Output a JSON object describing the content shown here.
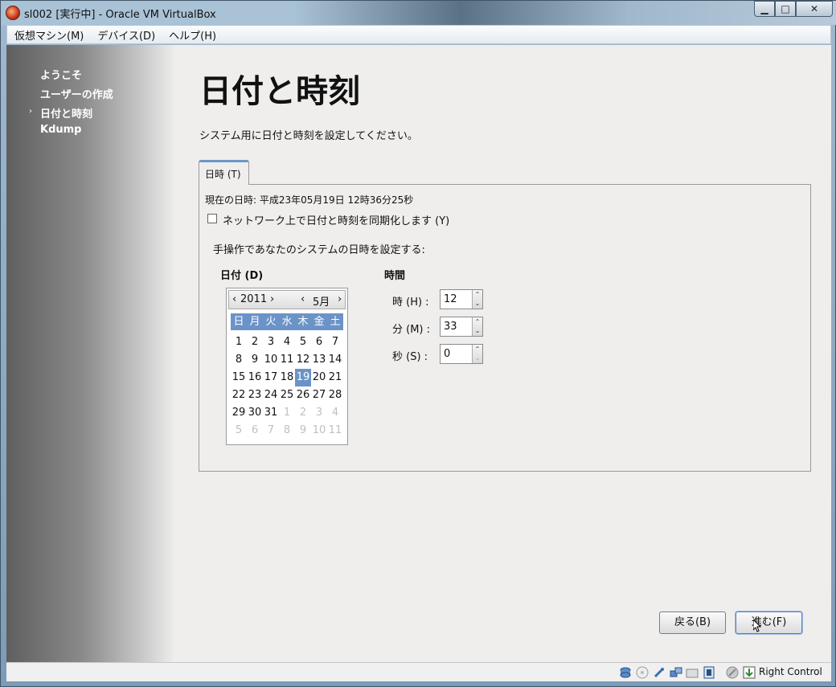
{
  "window": {
    "title": "sl002 [実行中] - Oracle VM VirtualBox",
    "min": "▁",
    "max": "□",
    "close": "✕"
  },
  "menubar": {
    "items": [
      {
        "label": "仮想マシン(M)"
      },
      {
        "label": "デバイス(D)"
      },
      {
        "label": "ヘルプ(H)"
      }
    ]
  },
  "sidebar": {
    "steps": [
      {
        "label": "ようこそ"
      },
      {
        "label": "ユーザーの作成"
      },
      {
        "label": "日付と時刻"
      },
      {
        "label": "Kdump"
      }
    ],
    "current_marker": "›"
  },
  "main": {
    "title": "日付と時刻",
    "instruction": "システム用に日付と時刻を設定してください。",
    "tab_label": "日時 (T)",
    "current_datetime": "現在の日時:  平成23年05月19日  12時36分25秒",
    "sync_label": "ネットワーク上で日付と時刻を同期化します (Y)",
    "sync_checked": false,
    "manual_label": "手操作であなたのシステムの日時を設定する:",
    "date_header": "日付 (D)",
    "time_header": "時間"
  },
  "calendar": {
    "year": "2011",
    "month": "5月",
    "prev": "‹",
    "next": "›",
    "weekdays": [
      "日",
      "月",
      "火",
      "水",
      "木",
      "金",
      "土"
    ],
    "days": [
      "1",
      "2",
      "3",
      "4",
      "5",
      "6",
      "7",
      "8",
      "9",
      "10",
      "11",
      "12",
      "13",
      "14",
      "15",
      "16",
      "17",
      "18",
      "19",
      "20",
      "21",
      "22",
      "23",
      "24",
      "25",
      "26",
      "27",
      "28",
      "29",
      "30",
      "31",
      "1",
      "2",
      "3",
      "4",
      "5",
      "6",
      "7",
      "8",
      "9",
      "10",
      "11"
    ],
    "selected": "19"
  },
  "time": {
    "hour_label": "時 (H) :",
    "hour": "12",
    "minute_label": "分 (M) :",
    "minute": "33",
    "second_label": "秒 (S) :",
    "second": "0",
    "up": "⌃",
    "down": "⌄"
  },
  "buttons": {
    "back": "戻る(B)",
    "next": "進む(F)"
  },
  "statusbar": {
    "host_key": "Right Control"
  }
}
